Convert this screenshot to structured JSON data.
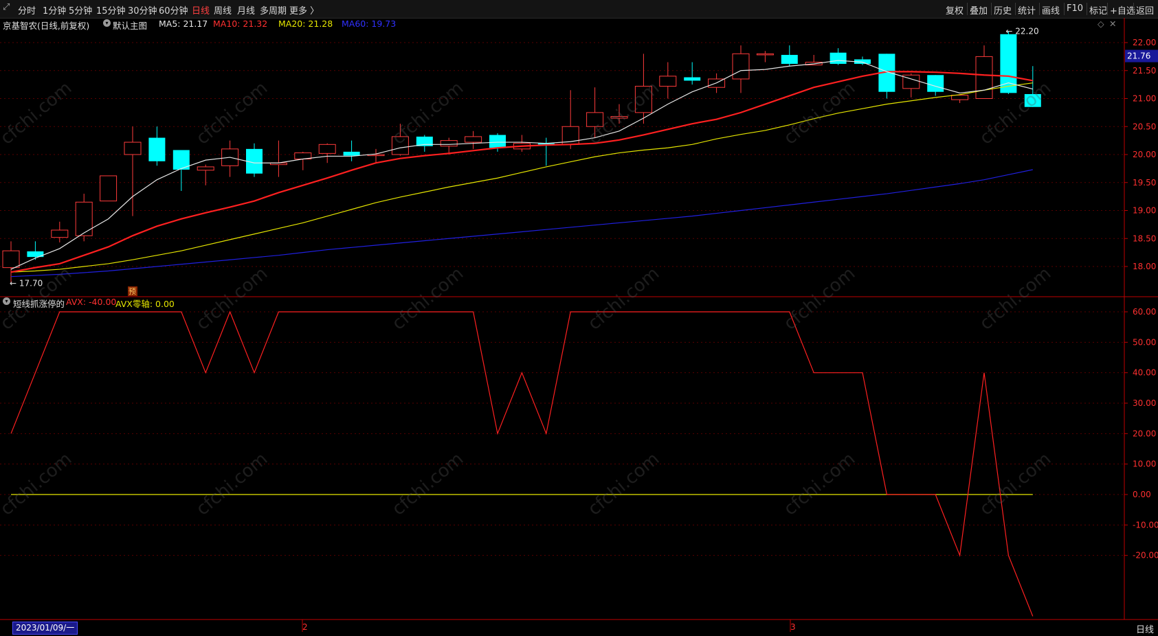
{
  "toolbar": {
    "left_items": [
      {
        "label": "分时",
        "active": false
      },
      {
        "label": "1分钟",
        "active": false
      },
      {
        "label": "5分钟",
        "active": false
      },
      {
        "label": "15分钟",
        "active": false
      },
      {
        "label": "30分钟",
        "active": false
      },
      {
        "label": "60分钟",
        "active": false
      },
      {
        "label": "日线",
        "active": true
      },
      {
        "label": "周线",
        "active": false
      },
      {
        "label": "月线",
        "active": false
      },
      {
        "label": "多周期",
        "active": false
      },
      {
        "label": "更多 〉",
        "active": false
      }
    ],
    "right_items": [
      "复权",
      "叠加",
      "历史",
      "统计",
      "画线",
      "F10",
      "标记",
      "+自选",
      "返回"
    ]
  },
  "main_header": {
    "stock": "京基智农(日线,前复权)",
    "chart_name": "默认主图",
    "ma5": "MA5: 21.17",
    "ma10": "MA10: 21.32",
    "ma20": "MA20: 21.28",
    "ma60": "MA60: 19.73"
  },
  "indicator_header": {
    "name": "短线抓涨停的",
    "avx": "AVX: -40.00",
    "avx_zero": "AVX零轴: 0.00"
  },
  "annotations": {
    "high_label": "22.20",
    "low_label": "17.70",
    "current_price": "21.76",
    "pre_marker": "预"
  },
  "footer": {
    "start_date": "2023/01/09/一",
    "month_2": "2",
    "month_3": "3",
    "period": "日线"
  },
  "watermark": "cfchi.com",
  "colors": {
    "up": "#ff3b3b",
    "down": "#00ffff",
    "ma5": "#e6e6e6",
    "ma10": "#ff2020",
    "ma20": "#e6e600",
    "ma60": "#2020e0",
    "avx": "#ff2020",
    "zero": "#e6e600",
    "axis": "#c00000"
  },
  "chart_data": [
    {
      "type": "candlestick",
      "price_axis_ticks": [
        18.0,
        18.5,
        19.0,
        19.5,
        20.0,
        20.5,
        21.0,
        21.5,
        22.0
      ],
      "ylim": [
        17.6,
        22.3
      ],
      "candles": [
        {
          "o": 17.98,
          "c": 18.28,
          "h": 18.45,
          "l": 17.72
        },
        {
          "o": 18.27,
          "c": 18.17,
          "h": 18.45,
          "l": 18.12
        },
        {
          "o": 18.52,
          "c": 18.65,
          "h": 18.8,
          "l": 18.43
        },
        {
          "o": 18.55,
          "c": 19.15,
          "h": 19.3,
          "l": 18.45
        },
        {
          "o": 19.17,
          "c": 19.62,
          "h": 19.62,
          "l": 19.17
        },
        {
          "o": 20.0,
          "c": 20.22,
          "h": 20.5,
          "l": 18.9
        },
        {
          "o": 20.3,
          "c": 19.88,
          "h": 20.5,
          "l": 19.8
        },
        {
          "o": 20.08,
          "c": 19.73,
          "h": 20.08,
          "l": 19.35
        },
        {
          "o": 19.72,
          "c": 19.78,
          "h": 19.82,
          "l": 19.45
        },
        {
          "o": 19.8,
          "c": 20.1,
          "h": 20.25,
          "l": 19.6
        },
        {
          "o": 20.1,
          "c": 19.66,
          "h": 20.2,
          "l": 19.6
        },
        {
          "o": 19.82,
          "c": 19.85,
          "h": 20.25,
          "l": 19.6
        },
        {
          "o": 19.92,
          "c": 20.03,
          "h": 20.05,
          "l": 19.72
        },
        {
          "o": 20.02,
          "c": 20.18,
          "h": 20.2,
          "l": 19.85
        },
        {
          "o": 20.05,
          "c": 19.98,
          "h": 20.25,
          "l": 19.88
        },
        {
          "o": 19.98,
          "c": 20.0,
          "h": 20.1,
          "l": 19.85
        },
        {
          "o": 20.0,
          "c": 20.32,
          "h": 20.55,
          "l": 19.98
        },
        {
          "o": 20.32,
          "c": 20.15,
          "h": 20.35,
          "l": 20.05
        },
        {
          "o": 20.15,
          "c": 20.25,
          "h": 20.3,
          "l": 20.0
        },
        {
          "o": 20.22,
          "c": 20.32,
          "h": 20.42,
          "l": 20.1
        },
        {
          "o": 20.35,
          "c": 20.12,
          "h": 20.38,
          "l": 20.05
        },
        {
          "o": 20.1,
          "c": 20.2,
          "h": 20.35,
          "l": 20.05
        },
        {
          "o": 20.2,
          "c": 20.18,
          "h": 20.3,
          "l": 19.8
        },
        {
          "o": 20.18,
          "c": 20.5,
          "h": 21.15,
          "l": 20.1
        },
        {
          "o": 20.5,
          "c": 20.75,
          "h": 21.2,
          "l": 20.3
        },
        {
          "o": 20.65,
          "c": 20.68,
          "h": 20.9,
          "l": 20.55
        },
        {
          "o": 20.75,
          "c": 21.22,
          "h": 21.8,
          "l": 20.55
        },
        {
          "o": 21.22,
          "c": 21.4,
          "h": 21.65,
          "l": 21.0
        },
        {
          "o": 21.38,
          "c": 21.32,
          "h": 21.65,
          "l": 21.25
        },
        {
          "o": 21.2,
          "c": 21.35,
          "h": 21.45,
          "l": 21.1
        },
        {
          "o": 21.35,
          "c": 21.8,
          "h": 21.95,
          "l": 21.1
        },
        {
          "o": 21.78,
          "c": 21.8,
          "h": 21.85,
          "l": 21.65
        },
        {
          "o": 21.78,
          "c": 21.62,
          "h": 21.95,
          "l": 21.58
        },
        {
          "o": 21.6,
          "c": 21.65,
          "h": 21.78,
          "l": 21.6
        },
        {
          "o": 21.82,
          "c": 21.62,
          "h": 21.9,
          "l": 21.6
        },
        {
          "o": 21.7,
          "c": 21.62,
          "h": 21.75,
          "l": 21.6
        },
        {
          "o": 21.8,
          "c": 21.12,
          "h": 21.8,
          "l": 21.0
        },
        {
          "o": 21.18,
          "c": 21.42,
          "h": 21.45,
          "l": 21.02
        },
        {
          "o": 21.42,
          "c": 21.12,
          "h": 21.42,
          "l": 21.05
        },
        {
          "o": 20.98,
          "c": 21.06,
          "h": 21.08,
          "l": 20.92
        },
        {
          "o": 21.0,
          "c": 21.75,
          "h": 21.95,
          "l": 21.0
        },
        {
          "o": 22.15,
          "c": 21.1,
          "h": 22.2,
          "l": 21.08
        },
        {
          "o": 21.08,
          "c": 20.85,
          "h": 21.58,
          "l": 20.85
        }
      ],
      "ma5": [
        17.95,
        18.15,
        18.32,
        18.6,
        18.85,
        19.25,
        19.55,
        19.75,
        19.9,
        19.95,
        19.85,
        19.85,
        19.92,
        19.97,
        19.97,
        20.01,
        20.12,
        20.18,
        20.18,
        20.2,
        20.22,
        20.22,
        20.2,
        20.23,
        20.3,
        20.42,
        20.65,
        20.9,
        21.12,
        21.28,
        21.5,
        21.52,
        21.58,
        21.62,
        21.68,
        21.65,
        21.48,
        21.35,
        21.22,
        21.1,
        21.15,
        21.28,
        21.17
      ],
      "ma10": [
        17.9,
        17.98,
        18.05,
        18.2,
        18.35,
        18.55,
        18.72,
        18.85,
        18.96,
        19.06,
        19.17,
        19.32,
        19.45,
        19.58,
        19.72,
        19.85,
        19.93,
        19.98,
        20.02,
        20.07,
        20.12,
        20.15,
        20.17,
        20.18,
        20.2,
        20.26,
        20.35,
        20.45,
        20.55,
        20.63,
        20.75,
        20.9,
        21.05,
        21.2,
        21.3,
        21.4,
        21.48,
        21.48,
        21.47,
        21.45,
        21.42,
        21.4,
        21.32
      ],
      "ma20": [
        17.9,
        17.92,
        17.95,
        18.0,
        18.05,
        18.12,
        18.2,
        18.28,
        18.38,
        18.48,
        18.58,
        18.68,
        18.78,
        18.9,
        19.02,
        19.14,
        19.24,
        19.33,
        19.42,
        19.5,
        19.58,
        19.68,
        19.78,
        19.87,
        19.96,
        20.03,
        20.08,
        20.12,
        20.18,
        20.28,
        20.36,
        20.43,
        20.53,
        20.64,
        20.74,
        20.82,
        20.9,
        20.96,
        21.02,
        21.07,
        21.15,
        21.22,
        21.28
      ],
      "ma60": [
        17.82,
        17.84,
        17.86,
        17.89,
        17.92,
        17.96,
        18.0,
        18.04,
        18.08,
        18.12,
        18.16,
        18.2,
        18.25,
        18.3,
        18.34,
        18.38,
        18.42,
        18.46,
        18.5,
        18.54,
        18.58,
        18.62,
        18.66,
        18.7,
        18.74,
        18.78,
        18.82,
        18.86,
        18.9,
        18.95,
        19.0,
        19.05,
        19.1,
        19.15,
        19.2,
        19.25,
        19.3,
        19.36,
        19.42,
        19.48,
        19.55,
        19.64,
        19.73
      ]
    },
    {
      "type": "line",
      "indicator_axis_ticks": [
        60,
        50,
        40,
        30,
        20,
        10,
        0,
        -10,
        -20
      ],
      "ylim": [
        -40,
        63
      ],
      "series": [
        {
          "name": "AVX",
          "values": [
            20,
            40,
            60,
            60,
            60,
            60,
            60,
            60,
            40,
            60,
            40,
            60,
            60,
            60,
            60,
            60,
            60,
            60,
            60,
            60,
            20,
            40,
            20,
            60,
            60,
            60,
            60,
            60,
            60,
            60,
            60,
            60,
            60,
            40,
            40,
            40,
            0,
            0,
            0,
            -20,
            40,
            -20,
            -40
          ]
        },
        {
          "name": "AVX零轴",
          "values": [
            0,
            0,
            0,
            0,
            0,
            0,
            0,
            0,
            0,
            0,
            0,
            0,
            0,
            0,
            0,
            0,
            0,
            0,
            0,
            0,
            0,
            0,
            0,
            0,
            0,
            0,
            0,
            0,
            0,
            0,
            0,
            0,
            0,
            0,
            0,
            0,
            0,
            0,
            0,
            0,
            0,
            0,
            0
          ]
        }
      ]
    }
  ]
}
